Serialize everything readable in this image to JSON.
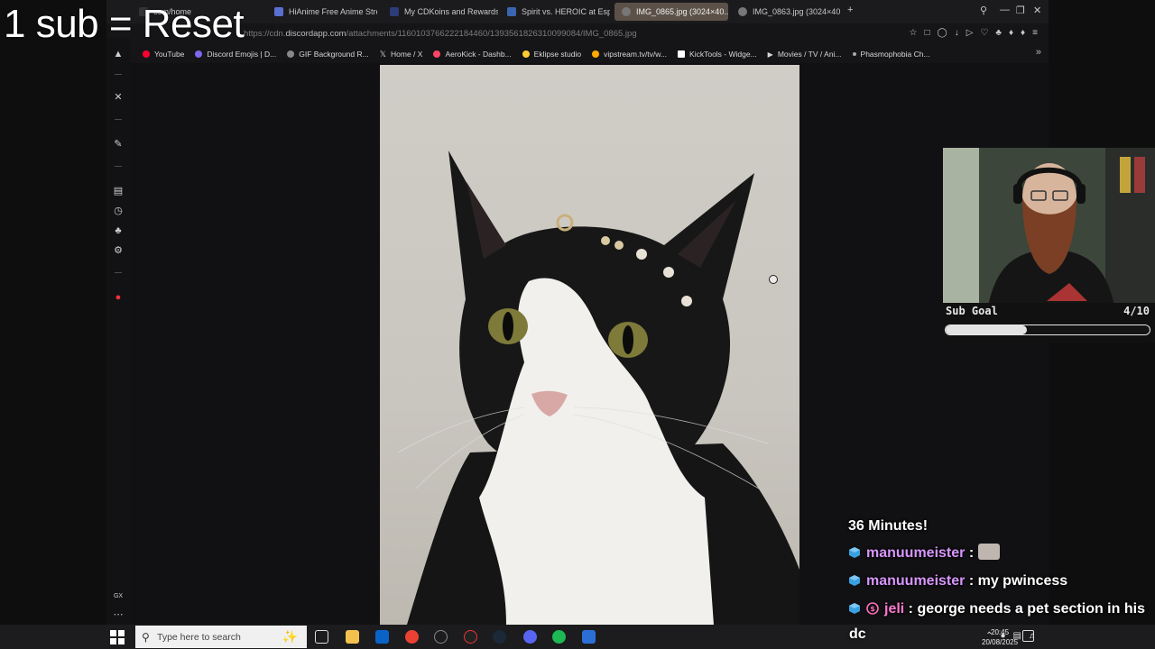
{
  "overlay": {
    "title": "1 sub = Reset"
  },
  "browser": {
    "tabs": [
      {
        "label": "com/home",
        "favicon": "X"
      },
      {
        "label": "HiAnime Free Anime Stre...",
        "favicon": "hi"
      },
      {
        "label": "My CDKoins and Rewards",
        "favicon": "cdk"
      },
      {
        "label": "Spirit vs. HEROIC at Espo...",
        "favicon": ""
      },
      {
        "label": "IMG_0865.jpg (3024×40...",
        "favicon": "",
        "active": true
      },
      {
        "label": "IMG_0863.jpg (3024×40...",
        "favicon": ""
      }
    ],
    "url_prefix": "https://cdn.",
    "url_host": "discordapp.com",
    "url_path": "/attachments/1160103766222184460/1393561826310099084/IMG_0865.jpg",
    "bookmarks": [
      {
        "label": "YouTube",
        "color": "#ff0033"
      },
      {
        "label": "Discord Emojis | D...",
        "color": "#7b68ee"
      },
      {
        "label": "GIF Background R...",
        "color": "#888888"
      },
      {
        "label": "Home / X",
        "color": "#ffffff"
      },
      {
        "label": "AeroKick - Dashb...",
        "color": "#ff4466"
      },
      {
        "label": "Eklipse studio",
        "color": "#ffcc33"
      },
      {
        "label": "vipstream.tv/tv/w...",
        "color": "#ffaa00"
      },
      {
        "label": "KickTools - Widge...",
        "color": "#ffffff"
      },
      {
        "label": "Movies / TV / Ani...",
        "color": "#ffffff"
      },
      {
        "label": "Phasmophobia Ch...",
        "color": "#aaaaaa"
      }
    ]
  },
  "stream": {
    "subgoal": {
      "label": "Sub Goal",
      "count_text": "4/10",
      "current": 4,
      "target": 10
    },
    "chat": {
      "timer": "36 Minutes!",
      "messages": [
        {
          "user": "manuumeister",
          "text": "",
          "badge": "cube-icon",
          "has_emote": true
        },
        {
          "user": "manuumeister",
          "text": "my pwincess",
          "badge": "cube-icon"
        },
        {
          "user": "jeli",
          "text": "george needs a pet section in his",
          "badge": "cube-icon",
          "sub_badge": true
        }
      ],
      "trailing": "dc"
    }
  },
  "taskbar": {
    "search_placeholder": "Type here to search",
    "time": "20:45",
    "date": "20/08/2025"
  }
}
